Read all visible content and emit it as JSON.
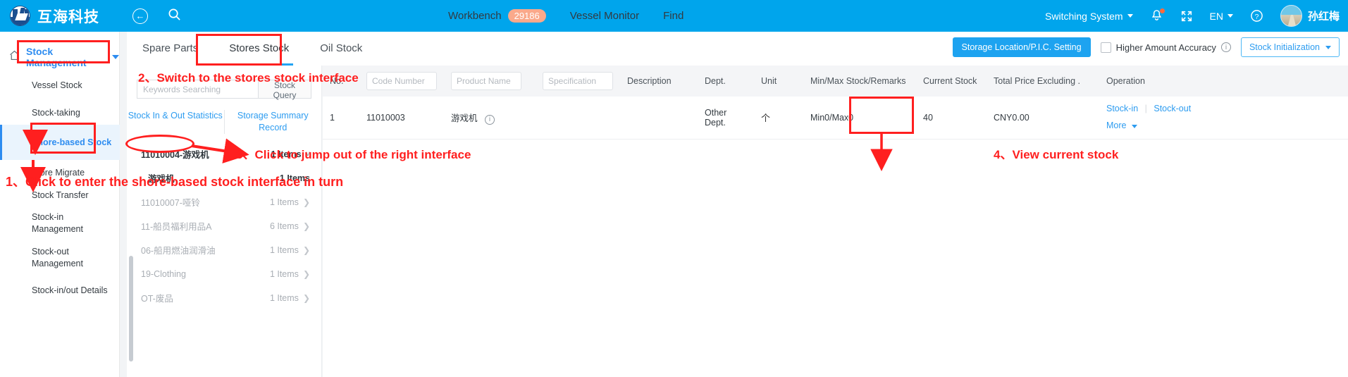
{
  "header": {
    "logo_text": "互海科技",
    "back_icon": "back-arrow-icon",
    "search_icon": "search-icon",
    "nav": [
      {
        "label": "Workbench",
        "badge": "29186"
      },
      {
        "label": "Vessel Monitor",
        "badge": ""
      },
      {
        "label": "Find",
        "badge": ""
      }
    ],
    "switching_system": "Switching System",
    "language": "EN",
    "user_name": "孙红梅",
    "bell_icon": "bell-icon",
    "fullscreen_icon": "fullscreen-icon",
    "help_icon": "question-mark-icon"
  },
  "sidebar": {
    "home_icon": "home-icon",
    "title": "Stock Management",
    "items": [
      {
        "label": "Vessel Stock",
        "active": false
      },
      {
        "label": "Stock-taking",
        "active": false
      },
      {
        "label": "Shore-based Stock",
        "active": true
      },
      {
        "label": "Store Migrate",
        "active": false
      },
      {
        "label": "Stock Transfer",
        "active": false
      },
      {
        "label": "Stock-in Management",
        "active": false
      },
      {
        "label": "Stock-out Management",
        "active": false
      },
      {
        "label": "Stock-in/out Details",
        "active": false
      }
    ]
  },
  "tabs": [
    {
      "label": "Spare Parts",
      "active": false
    },
    {
      "label": "Stores Stock",
      "active": true
    },
    {
      "label": "Oil Stock",
      "active": false
    }
  ],
  "toolbar": {
    "storage_location_button": "Storage Location/P.I.C. Setting",
    "higher_amount_accuracy": "Higher Amount Accuracy",
    "higher_amount_accuracy_checked": false,
    "stock_initialization": "Stock Initialization"
  },
  "category_panel": {
    "search_placeholder": "Keywords Searching",
    "search_button": "Stock Query",
    "links": [
      "Stock In & Out Statistics",
      "Storage Summary Record"
    ],
    "rows": [
      {
        "label": "11010004-游戏机",
        "count": "1 Items",
        "chevron": "chevron-down-icon",
        "level": 0,
        "muted": false
      },
      {
        "label": "游戏机",
        "count": "1 Items",
        "chevron": "",
        "level": 1,
        "muted": false
      },
      {
        "label": "11010007-哑铃",
        "count": "1 Items",
        "chevron": "chevron-right-icon",
        "level": 0,
        "muted": true
      },
      {
        "label": "11-船员福利用品A",
        "count": "6 Items",
        "chevron": "chevron-right-icon",
        "level": 0,
        "muted": true
      },
      {
        "label": "06-船用燃油润滑油",
        "count": "1 Items",
        "chevron": "chevron-right-icon",
        "level": 0,
        "muted": true
      },
      {
        "label": "19-Clothing",
        "count": "1 Items",
        "chevron": "chevron-right-icon",
        "level": 0,
        "muted": true
      },
      {
        "label": "OT-废品",
        "count": "1 Items",
        "chevron": "chevron-right-icon",
        "level": 0,
        "muted": true
      }
    ]
  },
  "table": {
    "columns": [
      {
        "label": "No.",
        "type": "text"
      },
      {
        "label": "",
        "type": "input",
        "placeholder": "Code Number"
      },
      {
        "label": "",
        "type": "input",
        "placeholder": "Product Name"
      },
      {
        "label": "",
        "type": "input",
        "placeholder": "Specification"
      },
      {
        "label": "Description",
        "type": "text"
      },
      {
        "label": "Dept.",
        "type": "text"
      },
      {
        "label": "Unit",
        "type": "text"
      },
      {
        "label": "Min/Max Stock/Remarks",
        "type": "text"
      },
      {
        "label": "Current Stock",
        "type": "text"
      },
      {
        "label": "Total Price Excluding .",
        "type": "text"
      },
      {
        "label": "Operation",
        "type": "text"
      }
    ],
    "rows": [
      {
        "no": "1",
        "code_number": "11010003",
        "product_name": "游戏机",
        "specification": "",
        "description": "",
        "dept": "Other Dept.",
        "unit": "个",
        "min_max": "Min0/Max0",
        "current_stock": "40",
        "total_price": "CNY0.00",
        "op_stock_in": "Stock-in",
        "op_stock_out": "Stock-out",
        "op_more": "More"
      }
    ]
  },
  "annotations": [
    {
      "id": "step1",
      "text": "1、Click to enter the shore-based stock interface in turn"
    },
    {
      "id": "step2",
      "text": "2、Switch to the stores stock interface"
    },
    {
      "id": "step3",
      "text": "3、Click to jump out of the right interface"
    },
    {
      "id": "step4",
      "text": "4、View current stock"
    }
  ],
  "colors": {
    "brand_blue": "#00a5ec",
    "accent_blue": "#2d9cf0",
    "annotation_red": "#ff1f1f",
    "badge_orange": "#faa98b"
  }
}
